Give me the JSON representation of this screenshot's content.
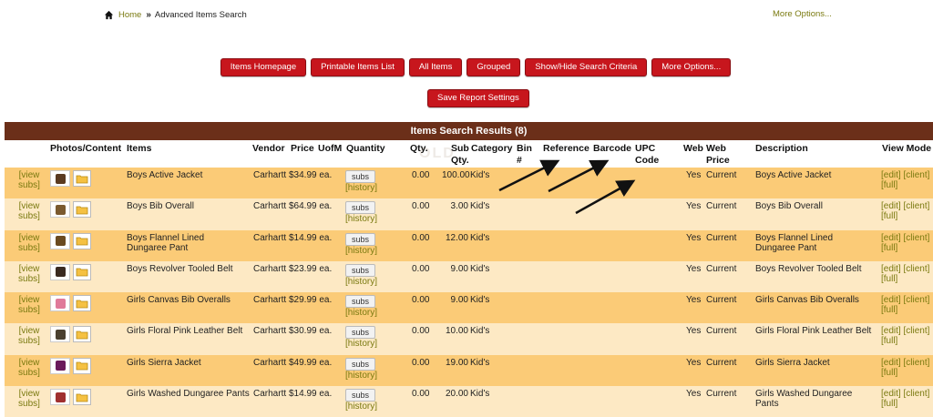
{
  "breadcrumb": {
    "home": "Home",
    "current": "Advanced Items Search"
  },
  "more_options_top": "More Options...",
  "buttons": [
    "Items Homepage",
    "Printable Items List",
    "All Items",
    "Grouped",
    "Show/Hide Search Criteria",
    "More Options..."
  ],
  "save_button": "Save Report Settings",
  "results_title": "Items Search Results (8)",
  "columns": {
    "photos": "Photos/Content",
    "items": "Items",
    "vendor": "Vendor",
    "price": "Price",
    "uofm": "UofM",
    "quantity": "Quantity",
    "qty": "Qty.",
    "sub_qty": "Sub Qty.",
    "category": "Category",
    "bin": "Bin #",
    "reference": "Reference",
    "barcode": "Barcode",
    "upc": "UPC Code",
    "web": "Web",
    "web_price": "Web Price",
    "description": "Description",
    "view_mode": "View Mode"
  },
  "links": {
    "view_subs": "[view subs]",
    "history": "[history]",
    "edit": "[edit]",
    "client": "[client]",
    "full": "[full]",
    "subs": "subs"
  },
  "rows": [
    {
      "item": "Boys Active Jacket",
      "vendor": "Carhartt",
      "price": "$34.99",
      "uofm": "ea.",
      "qty": "0.00",
      "sub_qty": "100.00",
      "category": "Kid's",
      "web": "Yes",
      "web_price": "Current",
      "description": "Boys Active Jacket",
      "thumb_color": "#5a3a20"
    },
    {
      "item": "Boys Bib Overall",
      "vendor": "Carhartt",
      "price": "$64.99",
      "uofm": "ea.",
      "qty": "0.00",
      "sub_qty": "3.00",
      "category": "Kid's",
      "web": "Yes",
      "web_price": "Current",
      "description": "Boys Bib Overall",
      "thumb_color": "#7a5a30"
    },
    {
      "item": "Boys Flannel Lined Dungaree Pant",
      "vendor": "Carhartt",
      "price": "$14.99",
      "uofm": "ea.",
      "qty": "0.00",
      "sub_qty": "12.00",
      "category": "Kid's",
      "web": "Yes",
      "web_price": "Current",
      "description": "Boys Flannel Lined Dungaree Pant",
      "thumb_color": "#6a4a20"
    },
    {
      "item": "Boys Revolver Tooled Belt",
      "vendor": "Carhartt",
      "price": "$23.99",
      "uofm": "ea.",
      "qty": "0.00",
      "sub_qty": "9.00",
      "category": "Kid's",
      "web": "Yes",
      "web_price": "Current",
      "description": "Boys Revolver Tooled Belt",
      "thumb_color": "#3a2a20"
    },
    {
      "item": "Girls Canvas Bib Overalls",
      "vendor": "Carhartt",
      "price": "$29.99",
      "uofm": "ea.",
      "qty": "0.00",
      "sub_qty": "9.00",
      "category": "Kid's",
      "web": "Yes",
      "web_price": "Current",
      "description": "Girls Canvas Bib Overalls",
      "thumb_color": "#e07a9a"
    },
    {
      "item": "Girls Floral Pink Leather Belt",
      "vendor": "Carhartt",
      "price": "$30.99",
      "uofm": "ea.",
      "qty": "0.00",
      "sub_qty": "10.00",
      "category": "Kid's",
      "web": "Yes",
      "web_price": "Current",
      "description": "Girls Floral Pink Leather Belt",
      "thumb_color": "#4a4030"
    },
    {
      "item": "Girls Sierra Jacket",
      "vendor": "Carhartt",
      "price": "$49.99",
      "uofm": "ea.",
      "qty": "0.00",
      "sub_qty": "19.00",
      "category": "Kid's",
      "web": "Yes",
      "web_price": "Current",
      "description": "Girls Sierra Jacket",
      "thumb_color": "#6a1a5a"
    },
    {
      "item": "Girls Washed Dungaree Pants",
      "vendor": "Carhartt",
      "price": "$14.99",
      "uofm": "ea.",
      "qty": "0.00",
      "sub_qty": "20.00",
      "category": "Kid's",
      "web": "Yes",
      "web_price": "Current",
      "description": "Girls Washed Dungaree Pants",
      "thumb_color": "#a03030"
    }
  ]
}
